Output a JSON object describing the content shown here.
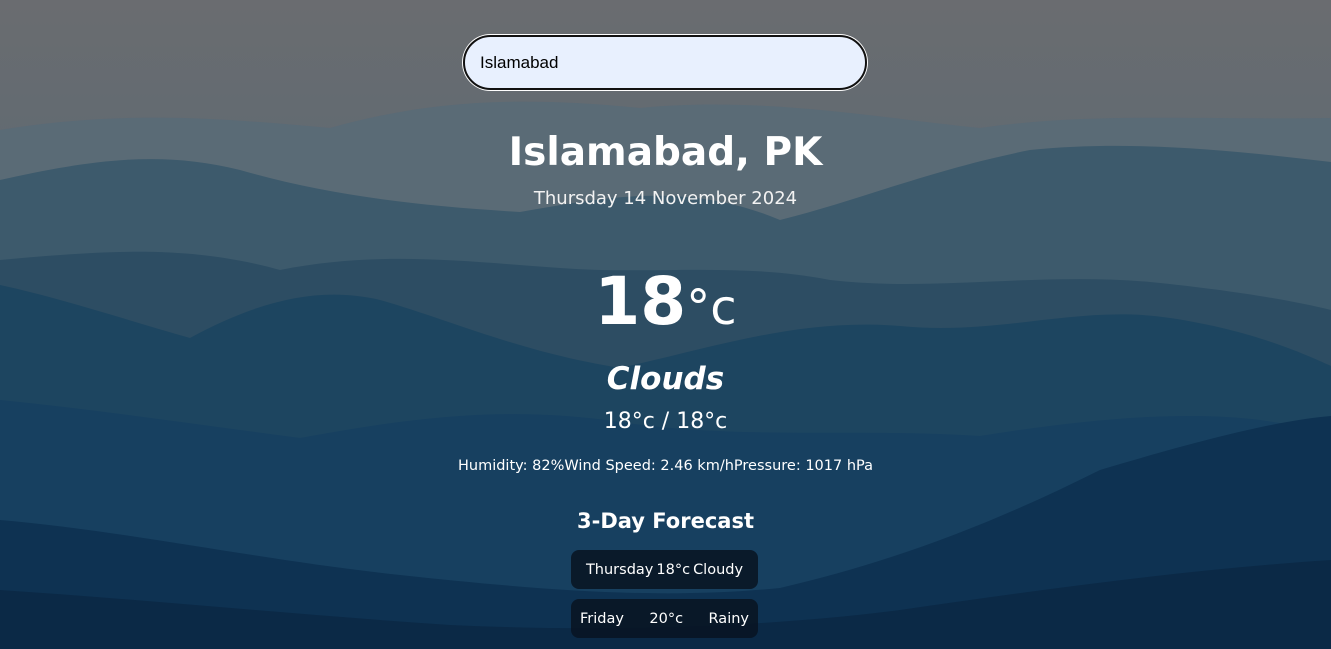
{
  "search": {
    "value": "Islamabad"
  },
  "location": {
    "city_country": "Islamabad, PK"
  },
  "date": "Thursday 14 November 2024",
  "current": {
    "temperature": "18",
    "unit": "°c",
    "condition": "Clouds",
    "hi_lo": "18°c / 18°c",
    "humidity": "Humidity: 82%",
    "wind": "Wind Speed: 2.46 km/h",
    "pressure": "Pressure: 1017 hPa"
  },
  "forecast": {
    "title": "3-Day Forecast",
    "days": [
      {
        "day": "Thursday",
        "temp": "18°c",
        "condition": "Cloudy"
      },
      {
        "day": "Friday",
        "temp": "20°c",
        "condition": "Rainy"
      }
    ]
  },
  "colors": {
    "sky": "#6b6f74",
    "mountain_dark": "#0b2a45",
    "forecast_card": "#0a1522",
    "search_bg": "#e8f0fe"
  }
}
